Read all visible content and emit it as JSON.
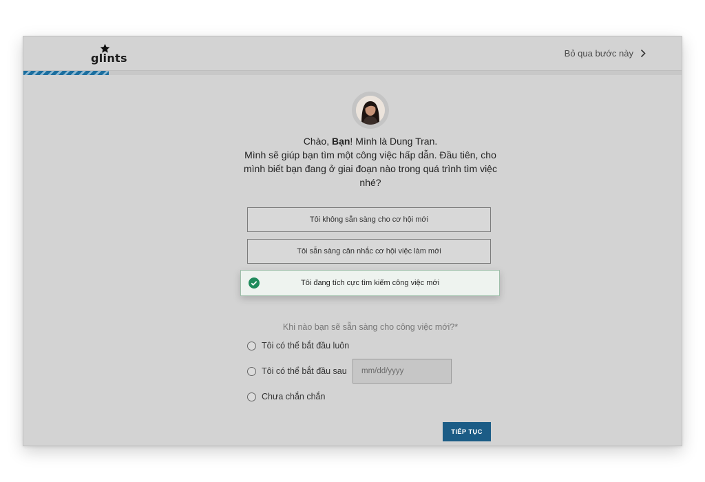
{
  "header": {
    "logo_text": "glints",
    "skip_label": "Bỏ qua bước này",
    "progress_fraction": 0.13,
    "progress_color": "#1c6e9e"
  },
  "recruiter": {
    "greeting_prefix": "Chào, ",
    "greeting_name": "Bạn",
    "greeting_suffix": "! Mình là Dung Tran.",
    "message": "Mình sẽ giúp bạn tìm một công việc hấp dẫn. Đầu tiên, cho mình biết bạn đang ở giai đoạn nào trong quá trình tìm việc nhé?"
  },
  "options": [
    {
      "label": "Tôi không sẵn sàng cho cơ hội mới",
      "selected": false
    },
    {
      "label": "Tôi sẵn sàng cân nhắc cơ hội việc làm mới",
      "selected": false
    },
    {
      "label": "Tôi đang tích cực tìm kiếm công việc mới",
      "selected": true
    }
  ],
  "availability": {
    "question": "Khi nào bạn sẽ sẵn sàng cho công việc mới?*",
    "choices": [
      {
        "label": "Tôi có thể bắt đầu luôn"
      },
      {
        "label": "Tôi có thể bắt đầu sau"
      },
      {
        "label": "Chưa chắn chắn"
      }
    ],
    "date_placeholder": "mm/dd/yyyy"
  },
  "continue_label": "TIẾP TỤC",
  "colors": {
    "accent": "#1b5c86",
    "selected_check": "#1f8a5b",
    "background": "#d3d3d3"
  }
}
